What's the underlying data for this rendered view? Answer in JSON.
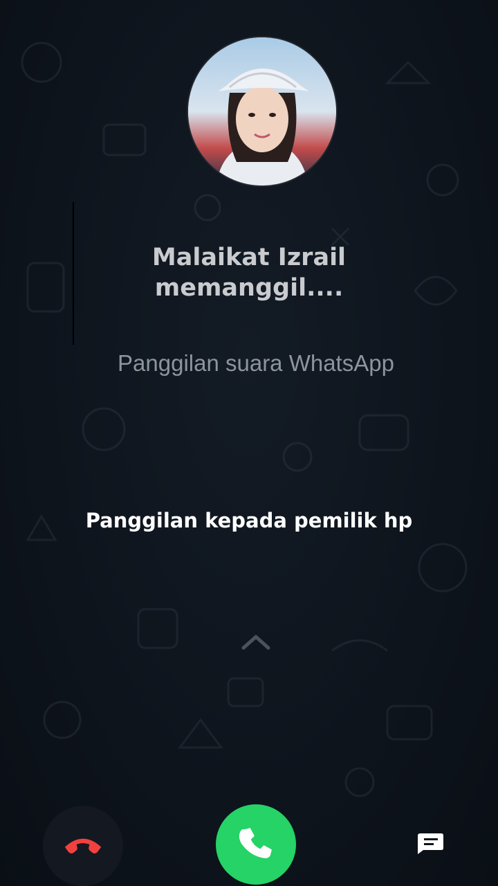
{
  "call": {
    "caller_name": "Malaikat  Izrail\nmemanggil....",
    "call_type": "Panggilan suara WhatsApp"
  },
  "caption": "Panggilan kepada pemilik hp",
  "controls": {
    "decline_icon": "phone-hangup-icon",
    "accept_icon": "phone-icon",
    "message_icon": "message-icon",
    "swipe_icon": "chevron-up-icon"
  },
  "colors": {
    "background": "#0e141c",
    "accept": "#25d366",
    "decline": "#f0413f"
  }
}
